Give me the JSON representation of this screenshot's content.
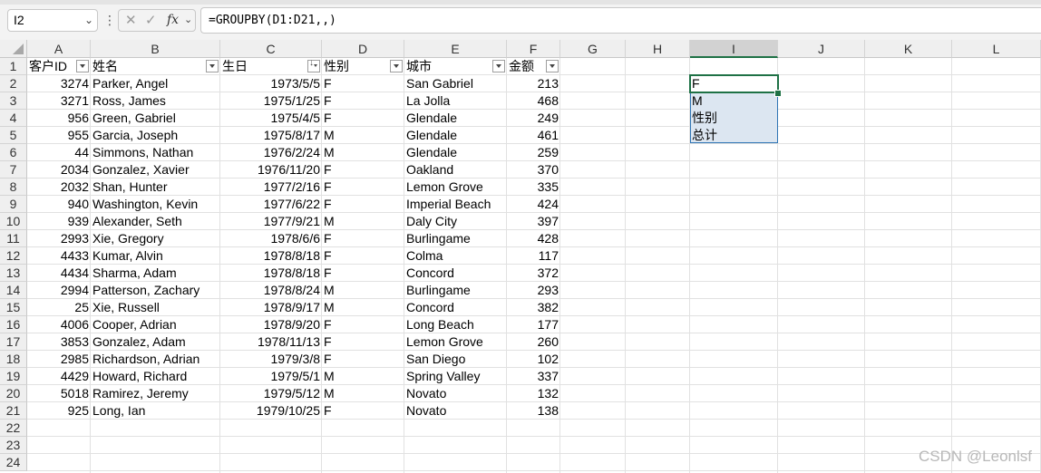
{
  "formula_bar": {
    "name_box": "I2",
    "formula": "=GROUPBY(D1:D21,,)",
    "fx_label": "fx",
    "dots": "⋮",
    "cancel_icon": "✕",
    "enter_icon": "✓"
  },
  "columns": [
    "A",
    "B",
    "C",
    "D",
    "E",
    "F",
    "G",
    "H",
    "I",
    "J",
    "K",
    "L"
  ],
  "selected_column": "I",
  "row_numbers": [
    "1",
    "2",
    "3",
    "4",
    "5",
    "6",
    "7",
    "8",
    "9",
    "10",
    "11",
    "12",
    "13",
    "14",
    "15",
    "16",
    "17",
    "18",
    "19",
    "20",
    "21",
    "22",
    "23",
    "24"
  ],
  "headers": {
    "a": "客户ID",
    "b": "姓名",
    "c": "生日",
    "d": "性别",
    "e": "城市",
    "f": "金额"
  },
  "rows": [
    {
      "id": "3274",
      "name": "Parker, Angel",
      "birthday": "1973/5/5",
      "gender": "F",
      "city": "San Gabriel",
      "amount": "213"
    },
    {
      "id": "3271",
      "name": "Ross, James",
      "birthday": "1975/1/25",
      "gender": "F",
      "city": "La Jolla",
      "amount": "468"
    },
    {
      "id": "956",
      "name": "Green, Gabriel",
      "birthday": "1975/4/5",
      "gender": "F",
      "city": "Glendale",
      "amount": "249"
    },
    {
      "id": "955",
      "name": "Garcia, Joseph",
      "birthday": "1975/8/17",
      "gender": "M",
      "city": "Glendale",
      "amount": "461"
    },
    {
      "id": "44",
      "name": "Simmons, Nathan",
      "birthday": "1976/2/24",
      "gender": "M",
      "city": "Glendale",
      "amount": "259"
    },
    {
      "id": "2034",
      "name": "Gonzalez, Xavier",
      "birthday": "1976/11/20",
      "gender": "F",
      "city": "Oakland",
      "amount": "370"
    },
    {
      "id": "2032",
      "name": "Shan, Hunter",
      "birthday": "1977/2/16",
      "gender": "F",
      "city": "Lemon Grove",
      "amount": "335"
    },
    {
      "id": "940",
      "name": "Washington, Kevin",
      "birthday": "1977/6/22",
      "gender": "F",
      "city": "Imperial Beach",
      "amount": "424"
    },
    {
      "id": "939",
      "name": "Alexander, Seth",
      "birthday": "1977/9/21",
      "gender": "M",
      "city": "Daly City",
      "amount": "397"
    },
    {
      "id": "2993",
      "name": "Xie, Gregory",
      "birthday": "1978/6/6",
      "gender": "F",
      "city": "Burlingame",
      "amount": "428"
    },
    {
      "id": "4433",
      "name": "Kumar, Alvin",
      "birthday": "1978/8/18",
      "gender": "F",
      "city": "Colma",
      "amount": "117"
    },
    {
      "id": "4434",
      "name": "Sharma, Adam",
      "birthday": "1978/8/18",
      "gender": "F",
      "city": "Concord",
      "amount": "372"
    },
    {
      "id": "2994",
      "name": "Patterson, Zachary",
      "birthday": "1978/8/24",
      "gender": "M",
      "city": "Burlingame",
      "amount": "293"
    },
    {
      "id": "25",
      "name": "Xie, Russell",
      "birthday": "1978/9/17",
      "gender": "M",
      "city": "Concord",
      "amount": "382"
    },
    {
      "id": "4006",
      "name": "Cooper, Adrian",
      "birthday": "1978/9/20",
      "gender": "F",
      "city": "Long Beach",
      "amount": "177"
    },
    {
      "id": "3853",
      "name": "Gonzalez, Adam",
      "birthday": "1978/11/13",
      "gender": "F",
      "city": "Lemon Grove",
      "amount": "260"
    },
    {
      "id": "2985",
      "name": "Richardson, Adrian",
      "birthday": "1979/3/8",
      "gender": "F",
      "city": "San Diego",
      "amount": "102"
    },
    {
      "id": "4429",
      "name": "Howard, Richard",
      "birthday": "1979/5/1",
      "gender": "M",
      "city": "Spring Valley",
      "amount": "337"
    },
    {
      "id": "5018",
      "name": "Ramirez, Jeremy",
      "birthday": "1979/5/12",
      "gender": "M",
      "city": "Novato",
      "amount": "132"
    },
    {
      "id": "925",
      "name": "Long, Ian",
      "birthday": "1979/10/25",
      "gender": "F",
      "city": "Novato",
      "amount": "138"
    }
  ],
  "spill_result": [
    "F",
    "M",
    "性别",
    "总计"
  ],
  "watermark": "CSDN @Leonlsf",
  "colors": {
    "selection_green": "#1e7145",
    "spill_fill": "#dce6f1",
    "spill_border": "#2f75b5"
  }
}
